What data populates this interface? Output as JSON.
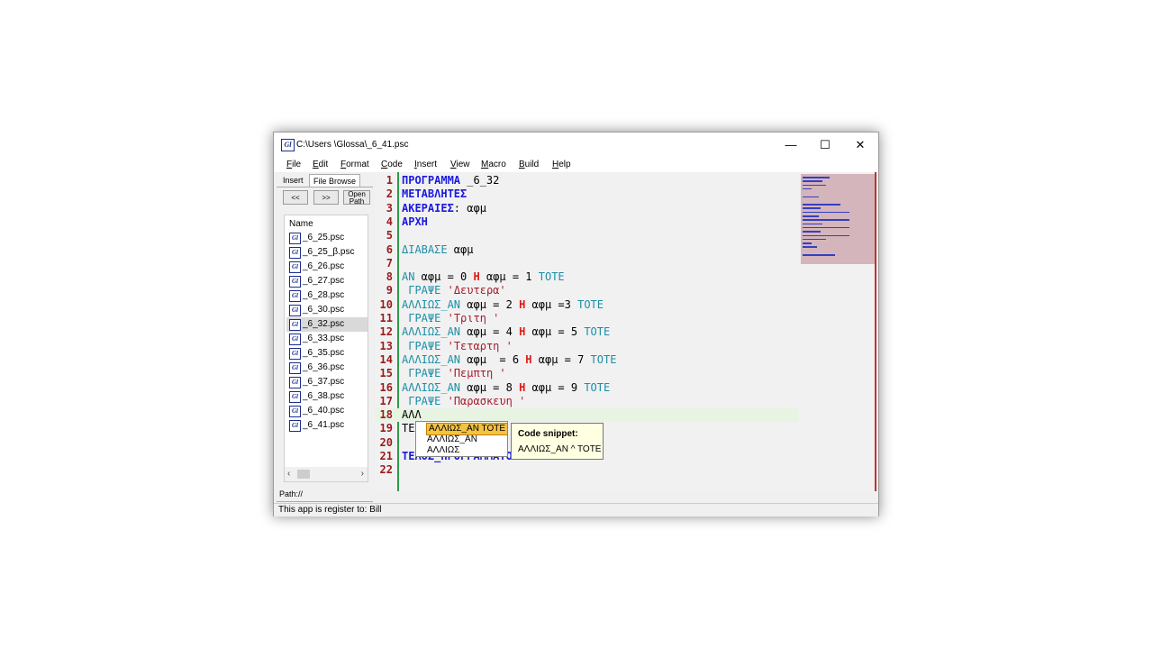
{
  "window": {
    "title": "C:\\Users  \\Glossa\\_6_41.psc",
    "icon": "Gl",
    "controls": [
      "minimize-icon",
      "maximize-icon",
      "close-icon"
    ],
    "minimize_glyph": "—",
    "maximize_glyph": "☐",
    "close_glyph": "✕"
  },
  "menu": [
    {
      "label": "File",
      "ul": "F",
      "rest": "ile"
    },
    {
      "label": "Edit",
      "ul": "E",
      "rest": "dit"
    },
    {
      "label": "Format",
      "ul": "F",
      "rest": "ormat"
    },
    {
      "label": "Code",
      "ul": "C",
      "rest": "ode"
    },
    {
      "label": "Insert",
      "ul": "I",
      "rest": "nsert"
    },
    {
      "label": "View",
      "ul": "V",
      "rest": "iew"
    },
    {
      "label": "Macro",
      "ul": "M",
      "rest": "acro"
    },
    {
      "label": "Build",
      "ul": "B",
      "rest": "uild"
    },
    {
      "label": "Help",
      "ul": "H",
      "rest": "elp"
    }
  ],
  "left_panel": {
    "tabs": [
      "Insert",
      "File Browse"
    ],
    "active_tab": "File Browse",
    "buttons": [
      "<<",
      ">>",
      "Open Path"
    ],
    "column_header": "Name",
    "files": [
      "_6_25.psc",
      "_6_25_β.psc",
      "_6_26.psc",
      "_6_27.psc",
      "_6_28.psc",
      "_6_30.psc",
      "_6_32.psc",
      "_6_33.psc",
      "_6_35.psc",
      "_6_36.psc",
      "_6_37.psc",
      "_6_38.psc",
      "_6_40.psc",
      "_6_41.psc"
    ],
    "selected_file": "_6_32.psc",
    "scroll_left": "‹",
    "scroll_right": "›",
    "path_label": "Path://"
  },
  "editor": {
    "current_line": 18,
    "lines": [
      {
        "n": "1",
        "text": "ΠΡΟΓΡΑΜΜΑ _6_32"
      },
      {
        "n": "2",
        "text": "ΜΕΤΑΒΛΗΤΕΣ"
      },
      {
        "n": "3",
        "text": "ΑΚΕΡΑΙΕΣ: αφμ"
      },
      {
        "n": "4",
        "text": "ΑΡΧΗ"
      },
      {
        "n": "5",
        "text": ""
      },
      {
        "n": "6",
        "text": "ΔΙΑΒΑΣΕ αφμ"
      },
      {
        "n": "7",
        "text": ""
      },
      {
        "n": "8",
        "text": "ΑΝ αφμ = 0 Η αφμ = 1 ΤΟΤΕ"
      },
      {
        "n": "9",
        "text": " ΓΡΑΨΕ 'Δευτερα'"
      },
      {
        "n": "10",
        "text": "ΑΛΛΙΩΣ_ΑΝ αφμ = 2 Η αφμ =3 ΤΟΤΕ"
      },
      {
        "n": "11",
        "text": " ΓΡΑΨΕ 'Τριτη '"
      },
      {
        "n": "12",
        "text": "ΑΛΛΙΩΣ_ΑΝ αφμ = 4 Η αφμ = 5 ΤΟΤΕ"
      },
      {
        "n": "13",
        "text": " ΓΡΑΨΕ 'Τεταρτη '"
      },
      {
        "n": "14",
        "text": "ΑΛΛΙΩΣ_ΑΝ αφμ  = 6 Η αφμ = 7 ΤΟΤΕ"
      },
      {
        "n": "15",
        "text": " ΓΡΑΨΕ 'Πεμπτη '"
      },
      {
        "n": "16",
        "text": "ΑΛΛΙΩΣ_ΑΝ αφμ = 8 Η αφμ = 9 ΤΟΤΕ"
      },
      {
        "n": "17",
        "text": " ΓΡΑΨΕ 'Παρασκευη '"
      },
      {
        "n": "18",
        "text": "ΑΛΛ"
      },
      {
        "n": "19",
        "text": "ΤΕΛ"
      },
      {
        "n": "20",
        "text": ""
      },
      {
        "n": "21",
        "text": "ΤΕΛΟΣ_ΠΡΟΓΡΑΜΜΑΤΟΣ"
      },
      {
        "n": "22",
        "text": ""
      }
    ]
  },
  "autocomplete": {
    "items": [
      "ΑΛΛΙΩΣ_ΑΝ  ΤΟΤΕ",
      "ΑΛΛΙΩΣ_ΑΝ",
      "ΑΛΛΙΩΣ"
    ],
    "selected_index": 0
  },
  "snippet_tooltip": {
    "title": "Code snippet:",
    "text": "ΑΛΛΙΩΣ_ΑΝ ^ ΤΟΤΕ"
  },
  "status": {
    "text": "This app is register to: Bill"
  },
  "colors": {
    "keyword_blue": "#1a1ae0",
    "keyword_cyan": "#1b8fa6",
    "operator_red": "#e01a1a",
    "string": "#a51d2d",
    "line_number": "#9b1a1a",
    "gutter_green": "#2e9a47",
    "current_line_bg": "#e7f4e1",
    "autocomplete_selected": "#f5c242",
    "tooltip_bg": "#ffffe1"
  }
}
